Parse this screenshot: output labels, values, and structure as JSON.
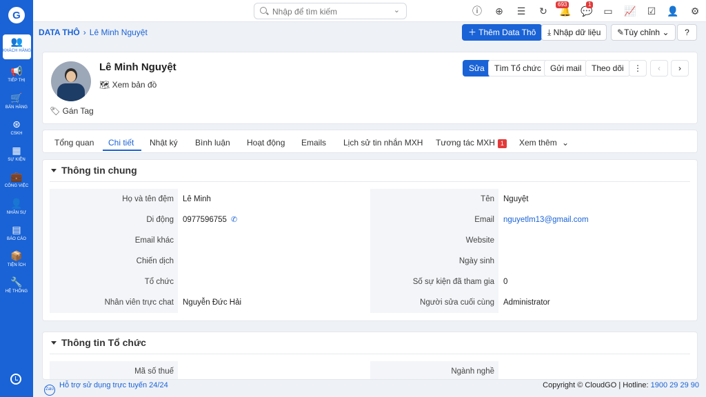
{
  "sidebar": {
    "logo": "G",
    "items": [
      {
        "label": "KHÁCH HÀNG",
        "icon": "users-icon"
      },
      {
        "label": "TIẾP THỊ",
        "icon": "megaphone-icon"
      },
      {
        "label": "BÁN HÀNG",
        "icon": "cart-icon"
      },
      {
        "label": "CSKH",
        "icon": "lifebuoy-icon"
      },
      {
        "label": "SỰ KIỆN",
        "icon": "calendar-icon"
      },
      {
        "label": "CÔNG VIỆC",
        "icon": "briefcase-icon"
      },
      {
        "label": "NHÂN SỰ",
        "icon": "person-icon"
      },
      {
        "label": "BÁO CÁO",
        "icon": "report-icon"
      },
      {
        "label": "TIỆN ÍCH",
        "icon": "box-icon"
      },
      {
        "label": "HỆ THỐNG",
        "icon": "wrench-icon"
      }
    ]
  },
  "topbar": {
    "search_placeholder": "Nhập để tìm kiếm",
    "notification_count": "693",
    "chat_count": "1"
  },
  "breadcrumb": {
    "root": "DATA THÔ",
    "current": "Lê Minh Nguyệt"
  },
  "toolbar": {
    "add_label": "Thêm Data Thô",
    "import_label": "Nhập dữ liệu",
    "customize_label": "Tùy chỉnh"
  },
  "profile": {
    "name": "Lê Minh Nguyệt",
    "map_label": "Xem bản đồ",
    "tag_label": "Gán Tag",
    "actions": {
      "edit": "Sửa",
      "find_org": "Tìm Tổ chức",
      "send_mail": "Gửi mail",
      "follow": "Theo dõi"
    }
  },
  "tabs": [
    {
      "label": "Tổng quan"
    },
    {
      "label": "Chi tiết",
      "active": true
    },
    {
      "label": "Nhật ký"
    },
    {
      "label": "Bình luận"
    },
    {
      "label": "Hoạt động"
    },
    {
      "label": "Emails"
    },
    {
      "label": "Lịch sử tin nhắn MXH"
    },
    {
      "label": "Tương tác MXH",
      "badge": "1"
    },
    {
      "label": "Xem thêm"
    }
  ],
  "general": {
    "title": "Thông tin chung",
    "left": [
      {
        "label": "Họ và tên đệm",
        "value": "Lê Minh"
      },
      {
        "label": "Di động",
        "value": "0977596755"
      },
      {
        "label": "Email khác",
        "value": ""
      },
      {
        "label": "Chiến dịch",
        "value": ""
      },
      {
        "label": "Tổ chức",
        "value": ""
      },
      {
        "label": "Nhân viên trực chat",
        "value": "Nguyễn Đức Hải"
      }
    ],
    "right": [
      {
        "label": "Tên",
        "value": "Nguyệt"
      },
      {
        "label": "Email",
        "value": "nguyetlm13@gmail.com"
      },
      {
        "label": "Website",
        "value": ""
      },
      {
        "label": "Ngày sinh",
        "value": ""
      },
      {
        "label": "Số sự kiện đã tham gia",
        "value": "0"
      },
      {
        "label": "Người sửa cuối cùng",
        "value": "Administrator"
      }
    ]
  },
  "org": {
    "title": "Thông tin Tổ chức",
    "left": [
      {
        "label": "Mã số thuế",
        "value": ""
      }
    ],
    "right": [
      {
        "label": "Ngành nghề",
        "value": ""
      }
    ]
  },
  "footer": {
    "support": "Hỗ trợ sử dụng trực tuyến 24/24",
    "copyright": "Copyright © CloudGO",
    "hotline_label": "Hotline:",
    "hotline": "1900 29 29 90"
  },
  "colors": {
    "primary": "#1a63d6",
    "badge": "#e23a3a",
    "sidebar": "#1a63d6"
  }
}
